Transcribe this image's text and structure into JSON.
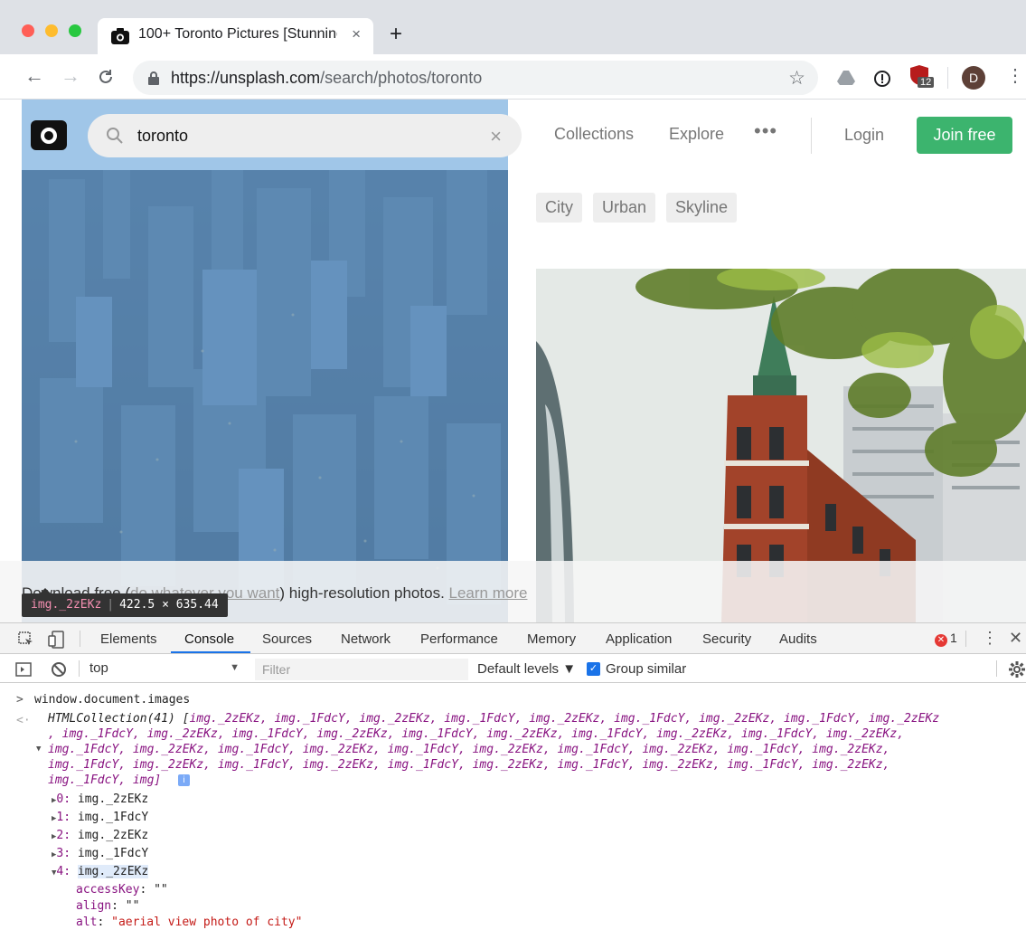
{
  "browser": {
    "tab_title": "100+ Toronto Pictures [Stunning",
    "tab_close": "×",
    "new_tab": "+",
    "url_host": "https://unsplash.com",
    "url_path": "/search/photos/toronto",
    "extension_badge": "12",
    "avatar_letter": "D"
  },
  "page": {
    "search_value": "toronto",
    "search_clear": "×",
    "nav": [
      "Collections",
      "Explore"
    ],
    "more": "•••",
    "login": "Login",
    "join": "Join free",
    "tags": [
      "City",
      "Urban",
      "Skyline"
    ],
    "banner_pre": "Download free (",
    "banner_link": "do whatever you want",
    "banner_post": ") high-resolution photos. ",
    "banner_learn": "Learn more",
    "tooltip_sel": "img._2zEKz",
    "tooltip_size": "422.5 × 635.44"
  },
  "devtools": {
    "tabs": [
      "Elements",
      "Console",
      "Sources",
      "Network",
      "Performance",
      "Memory",
      "Application",
      "Security",
      "Audits"
    ],
    "active_tab": "Console",
    "error_count": "1",
    "context": "top",
    "filter_placeholder": "Filter",
    "levels": "Default levels ▼",
    "group_similar": "Group similar",
    "console": {
      "command": "window.document.images",
      "collection_head": "HTMLCollection(41) [",
      "collection_lines": [
        "img._2zEKz, img._1FdcY, img._2zEKz, img._1FdcY, img._2zEKz, img._1FdcY, img._2zEKz, img._1FdcY, img._2zEKz",
        ", img._1FdcY, img._2zEKz, img._1FdcY, img._2zEKz, img._1FdcY, img._2zEKz, img._1FdcY, img._2zEKz, img._1FdcY, img._2zEKz,",
        "img._1FdcY, img._2zEKz, img._1FdcY, img._2zEKz, img._1FdcY, img._2zEKz, img._1FdcY, img._2zEKz, img._1FdcY, img._2zEKz,",
        "img._1FdcY, img._2zEKz, img._1FdcY, img._2zEKz, img._1FdcY, img._2zEKz, img._1FdcY, img._2zEKz, img._1FdcY, img._2zEKz,",
        "img._1FdcY, img]"
      ],
      "items": [
        {
          "index": "0",
          "value": "img._2zEKz"
        },
        {
          "index": "1",
          "value": "img._1FdcY"
        },
        {
          "index": "2",
          "value": "img._2zEKz"
        },
        {
          "index": "3",
          "value": "img._1FdcY"
        },
        {
          "index": "4",
          "value": "img._2zEKz"
        }
      ],
      "props": [
        {
          "key": "accessKey",
          "value": "\"\""
        },
        {
          "key": "align",
          "value": "\"\""
        },
        {
          "key": "alt",
          "value": "\"aerial view photo of city\""
        }
      ]
    }
  }
}
